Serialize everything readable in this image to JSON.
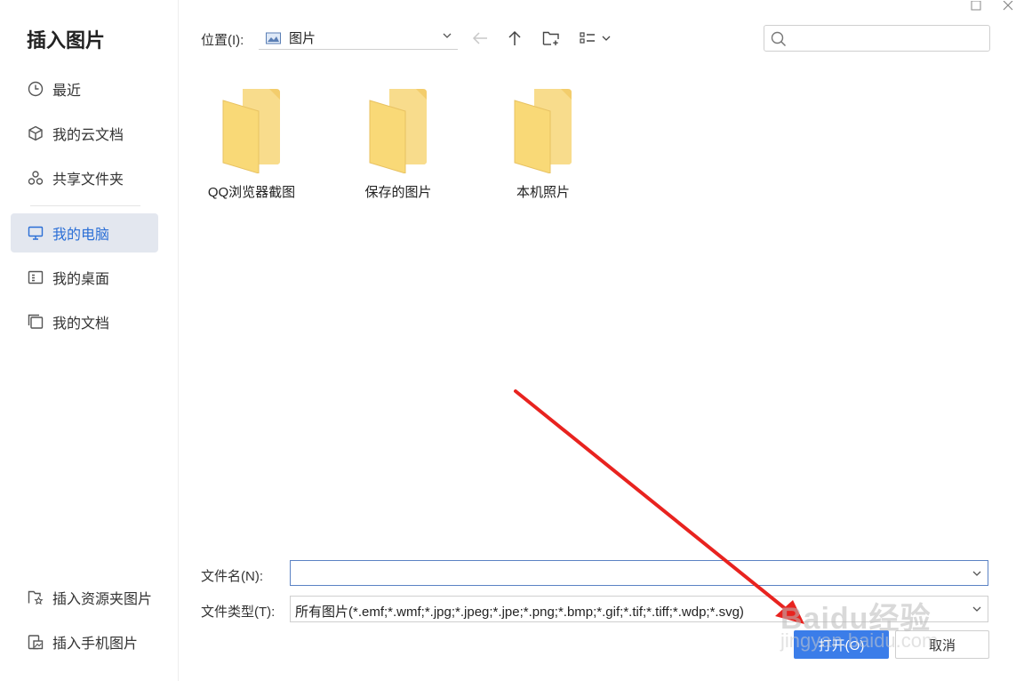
{
  "dialog": {
    "title": "插入图片"
  },
  "sidebar": {
    "items": [
      {
        "label": "最近",
        "icon": "clock-icon"
      },
      {
        "label": "我的云文档",
        "icon": "cloud-box-icon"
      },
      {
        "label": "共享文件夹",
        "icon": "share-nodes-icon"
      },
      {
        "label": "我的电脑",
        "icon": "monitor-icon",
        "active": true
      },
      {
        "label": "我的桌面",
        "icon": "desktop-icon"
      },
      {
        "label": "我的文档",
        "icon": "documents-icon"
      }
    ],
    "bottom_items": [
      {
        "label": "插入资源夹图片",
        "icon": "folder-star-icon"
      },
      {
        "label": "插入手机图片",
        "icon": "phone-image-icon"
      }
    ]
  },
  "toolbar": {
    "location_label": "位置(I):",
    "location_value": "图片",
    "search_placeholder": ""
  },
  "folders": [
    {
      "name": "QQ浏览器截图"
    },
    {
      "name": "保存的图片"
    },
    {
      "name": "本机照片"
    }
  ],
  "form": {
    "filename_label": "文件名(N):",
    "filename_value": "",
    "filetype_label": "文件类型(T):",
    "filetype_value": "所有图片(*.emf;*.wmf;*.jpg;*.jpeg;*.jpe;*.png;*.bmp;*.gif;*.tif;*.tiff;*.wdp;*.svg)"
  },
  "buttons": {
    "open_label": "打开(O)",
    "cancel_label": "取消"
  },
  "colors": {
    "accent": "#3b7de9",
    "active_nav_bg": "#e3e7ef",
    "folder_yellow": "#f7d67a",
    "annotation_red": "#e8231f"
  },
  "watermark": {
    "text": "Baidu经验",
    "sub": "jingyan.baidu.com"
  }
}
